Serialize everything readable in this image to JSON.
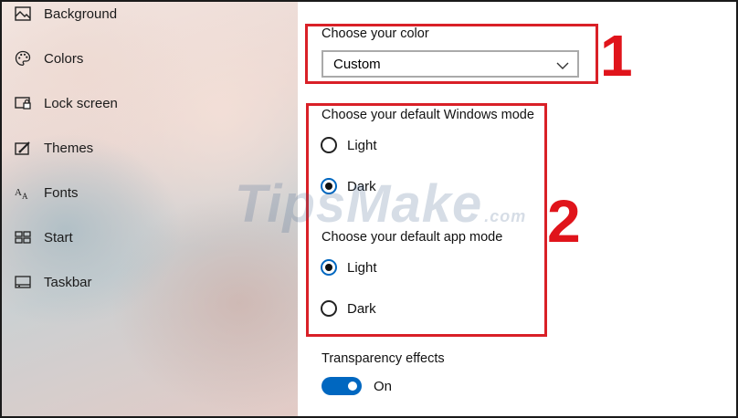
{
  "sidebar": {
    "items": [
      {
        "label": "Background",
        "icon": "image-icon"
      },
      {
        "label": "Colors",
        "icon": "palette-icon"
      },
      {
        "label": "Lock screen",
        "icon": "lock-screen-icon"
      },
      {
        "label": "Themes",
        "icon": "themes-icon"
      },
      {
        "label": "Fonts",
        "icon": "fonts-icon"
      },
      {
        "label": "Start",
        "icon": "start-icon"
      },
      {
        "label": "Taskbar",
        "icon": "taskbar-icon"
      }
    ]
  },
  "color": {
    "heading": "Choose your color",
    "selected": "Custom"
  },
  "windows_mode": {
    "heading": "Choose your default Windows mode",
    "options": [
      {
        "label": "Light",
        "selected": false
      },
      {
        "label": "Dark",
        "selected": true
      }
    ]
  },
  "app_mode": {
    "heading": "Choose your default app mode",
    "options": [
      {
        "label": "Light",
        "selected": true
      },
      {
        "label": "Dark",
        "selected": false
      }
    ]
  },
  "transparency": {
    "heading": "Transparency effects",
    "state": "On"
  },
  "annotations": {
    "first": "1",
    "second": "2"
  },
  "watermark": {
    "text": "TipsMake",
    "suffix": ".com"
  },
  "colors": {
    "accent": "#0067c0",
    "annotation_red": "#d92027"
  }
}
